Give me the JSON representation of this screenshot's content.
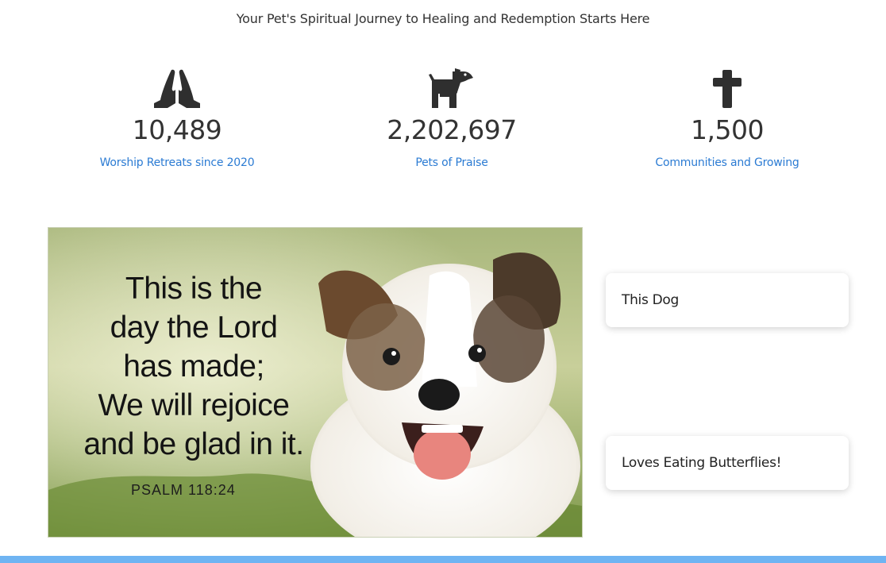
{
  "tagline": "Your Pet's Spiritual Journey to Healing and Redemption Starts Here",
  "stats": [
    {
      "icon": "praying-hands-icon",
      "number": "10,489",
      "label": "Worship Retreats since 2020"
    },
    {
      "icon": "dog-icon",
      "number": "2,202,697",
      "label": "Pets of Praise"
    },
    {
      "icon": "cross-icon",
      "number": "1,500",
      "label": "Communities and Growing"
    }
  ],
  "feature_image": {
    "verse_lines": [
      "This is the",
      "day the Lord",
      "has made;",
      "We will rejoice",
      "and be glad in it."
    ],
    "reference": "PSALM 118:24"
  },
  "cards": [
    {
      "text": "This Dog"
    },
    {
      "text": "Loves Eating Butterflies!"
    }
  ],
  "colors": {
    "link": "#2b7bd3",
    "icon": "#2f2f2f",
    "footer_bar": "#6fb4f2"
  }
}
